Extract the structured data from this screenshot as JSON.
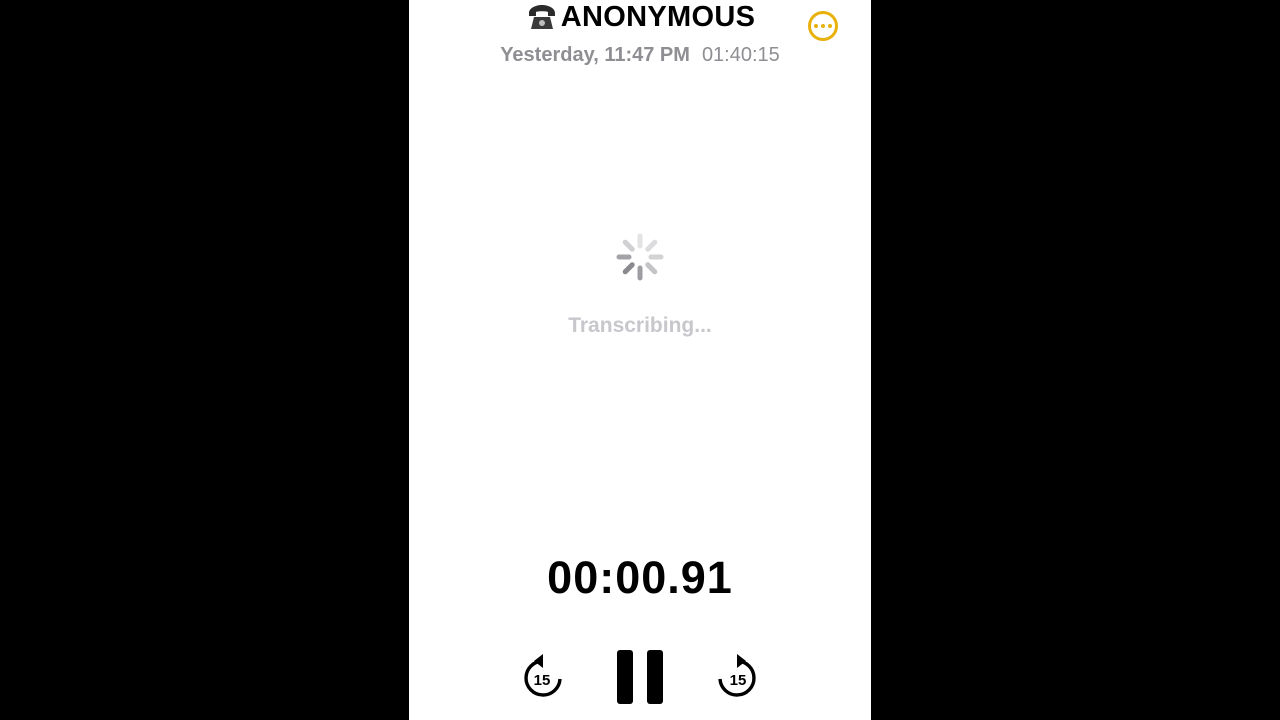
{
  "header": {
    "title": "ANONYMOUS",
    "date": "Yesterday, 11:47 PM",
    "duration": "01:40:15"
  },
  "status": {
    "text": "Transcribing..."
  },
  "player": {
    "elapsed": "00:00.91",
    "skip_back_seconds": "15",
    "skip_forward_seconds": "15"
  },
  "colors": {
    "accent": "#e8b10c",
    "secondary_text": "#8e8e93",
    "placeholder_text": "#c7c7cc"
  },
  "icons": {
    "title": "phone-icon",
    "menu": "ellipsis-circle-icon",
    "loading": "spinner-icon",
    "back": "skip-back-15-icon",
    "play_state": "pause-icon",
    "forward": "skip-forward-15-icon"
  }
}
